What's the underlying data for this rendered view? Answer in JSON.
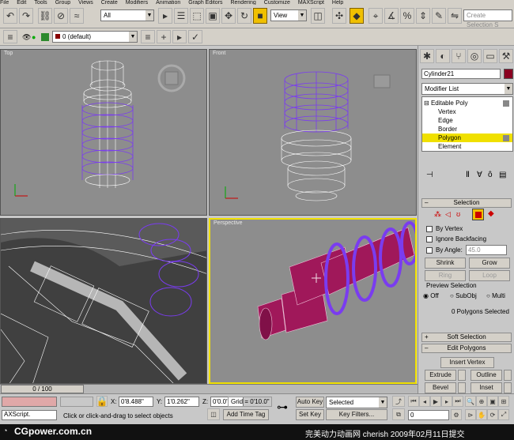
{
  "menu": [
    "File",
    "Edit",
    "Tools",
    "Group",
    "Views",
    "Create",
    "Modifiers",
    "Animation",
    "Graph Editors",
    "Rendering",
    "Customize",
    "MAXScript",
    "Help"
  ],
  "toolbar": {
    "selection_filter": "All",
    "reference_coord": "View",
    "named_selection_placeholder": "Create Selection S"
  },
  "layer": {
    "current": "0 (default)"
  },
  "viewports": {
    "top": "Top",
    "front": "Front",
    "left": "",
    "perspective": "Perspective"
  },
  "command_panel": {
    "object_name": "Cylinder21",
    "modifier_list": "Modifier List",
    "stack": [
      "Editable Poly",
      "Vertex",
      "Edge",
      "Border",
      "Polygon",
      "Element"
    ],
    "selected_stack_item": "Polygon",
    "selection_rollout": "Selection",
    "by_vertex": "By Vertex",
    "ignore_backfacing": "Ignore Backfacing",
    "by_angle": "By Angle:",
    "by_angle_value": "45.0",
    "shrink": "Shrink",
    "grow": "Grow",
    "ring": "Ring",
    "loop": "Loop",
    "preview_selection": "Preview Selection",
    "preview_off": "Off",
    "preview_subobj": "SubObj",
    "preview_multi": "Multi",
    "selection_info": "0 Polygons Selected",
    "soft_selection": "Soft Selection",
    "edit_polygons": "Edit Polygons",
    "insert_vertex": "Insert Vertex",
    "extrude": "Extrude",
    "outline": "Outline",
    "bevel": "Bevel",
    "inset": "Inset"
  },
  "status": {
    "frame_counter": "0 / 100",
    "x_label": "X:",
    "x_value": "0'8.488\"",
    "y_label": "Y:",
    "y_value": "1'0.262\"",
    "z_label": "Z:",
    "z_value": "0'0.0\"",
    "grid": "Grid = 0'10.0\"",
    "auto_key": "Auto Key",
    "set_key": "Set Key",
    "key_mode": "Selected",
    "key_filters": "Key Filters...",
    "current_frame": "0",
    "maxscript": "AXScript.",
    "prompt": "Click or click-and-drag to select objects",
    "add_time_tag": "Add Time Tag"
  },
  "watermark": {
    "left": "CGpower.com.cn",
    "right": "完美动力动画网 cherish 2009年02月11日提交"
  },
  "colors": {
    "ui_gray": "#d4d0c8",
    "viewport_gray": "#8d8d8d",
    "active_yellow": "#f0c000",
    "wire_purple": "#7a3cf0",
    "mesh_magenta": "#a0185a"
  }
}
